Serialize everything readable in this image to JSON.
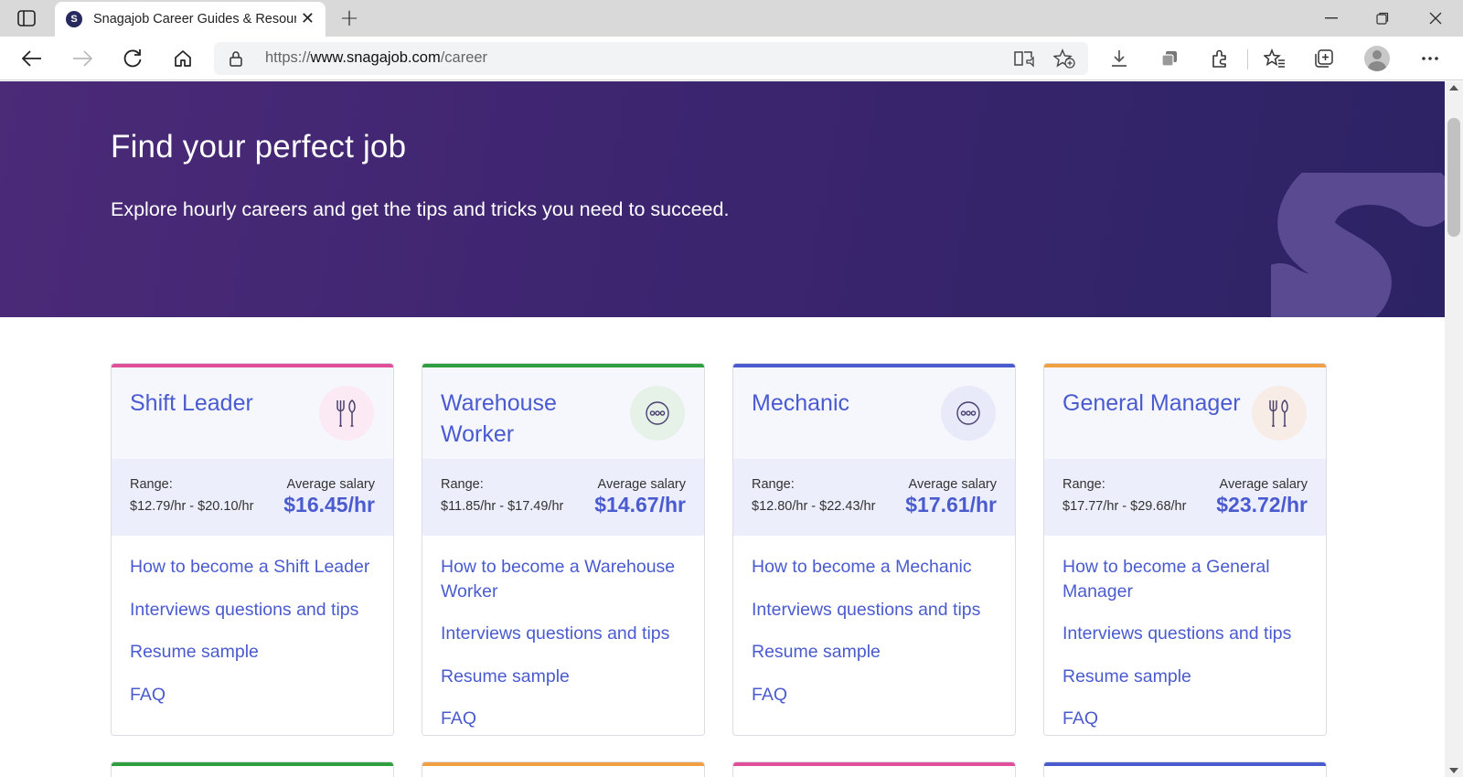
{
  "browser": {
    "tab_title": "Snagajob Career Guides & Resources",
    "favicon_letter": "S",
    "url_scheme": "https://",
    "url_host": "www.snagajob.com",
    "url_path": "/career"
  },
  "hero": {
    "title": "Find your perfect job",
    "subtitle": "Explore hourly careers and get the tips and tricks you need to succeed."
  },
  "labels": {
    "range": "Range:",
    "average": "Average salary"
  },
  "cards": [
    {
      "title": "Shift Leader",
      "accent": "#e0509a",
      "icon": "fork-knife-icon",
      "icon_bg": "#fbe9f3",
      "range": "$12.79/hr - $20.10/hr",
      "average": "$16.45/hr",
      "links": [
        "How to become a Shift Leader",
        "Interviews questions and tips",
        "Resume sample",
        "FAQ"
      ]
    },
    {
      "title": "Warehouse Worker",
      "accent": "#2e9e3e",
      "icon": "ellipsis-icon",
      "icon_bg": "#e6f2e7",
      "range": "$11.85/hr - $17.49/hr",
      "average": "$14.67/hr",
      "links": [
        "How to become a Warehouse Worker",
        "Interviews questions and tips",
        "Resume sample",
        "FAQ"
      ]
    },
    {
      "title": "Mechanic",
      "accent": "#4a5bcf",
      "icon": "ellipsis-icon",
      "icon_bg": "#e8eafa",
      "range": "$12.80/hr - $22.43/hr",
      "average": "$17.61/hr",
      "links": [
        "How to become a Mechanic",
        "Interviews questions and tips",
        "Resume sample",
        "FAQ"
      ]
    },
    {
      "title": "General Manager",
      "accent": "#f0a040",
      "icon": "fork-knife-icon",
      "icon_bg": "#f8ede6",
      "range": "$17.77/hr - $29.68/hr",
      "average": "$23.72/hr",
      "links": [
        "How to become a General Manager",
        "Interviews questions and tips",
        "Resume sample",
        "FAQ"
      ]
    }
  ],
  "next_row_accents": [
    "#2e9e3e",
    "#f0a040",
    "#e0509a",
    "#4a5bcf"
  ],
  "colors": {
    "brand_purple": "#3d2570",
    "link_blue": "#4a5bcf"
  }
}
